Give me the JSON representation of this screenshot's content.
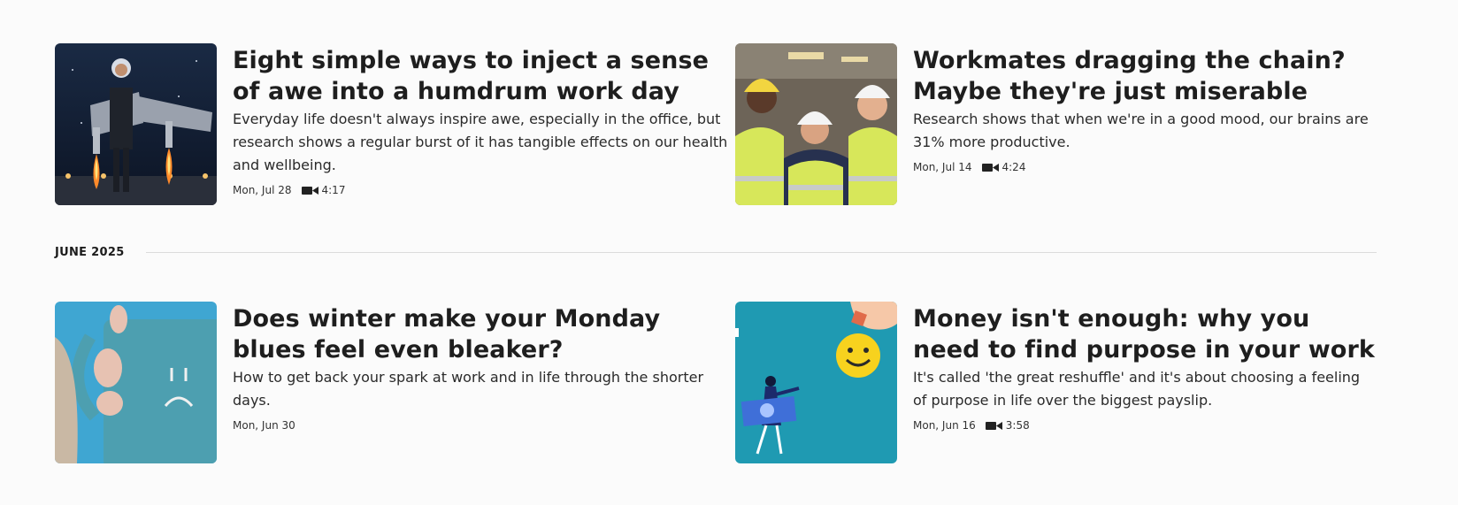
{
  "articles": [
    {
      "title": "Eight simple ways to inject a sense of awe into a humdrum work day",
      "description": "Everyday life doesn't always inspire awe, especially in the office, but research shows a regular burst of it has tangible effects on our health and wellbeing.",
      "date": "Mon, Jul 28",
      "duration": "4:17",
      "image": "jetpack-businessman"
    },
    {
      "title": "Workmates dragging the chain? Maybe they're just miserable",
      "description": "Research shows that when we're in a good mood, our brains are 31% more productive.",
      "date": "Mon, Jul 14",
      "duration": "4:24",
      "image": "construction-workers"
    },
    {
      "title": "Does winter make your Monday blues feel even bleaker?",
      "description": "How to get back your spark at work and in life through the shorter days.",
      "date": "Mon, Jun 30",
      "duration": "",
      "image": "sad-mug"
    },
    {
      "title": "Money isn't enough: why you need to find purpose in your work",
      "description": "It's called 'the great reshuffle' and it's about choosing a feeling of purpose in life over the biggest payslip.",
      "date": "Mon, Jun 16",
      "duration": "3:58",
      "image": "money-and-smile"
    }
  ],
  "section_label": "JUNE 2025",
  "colors": {
    "text": "#1e1e1e",
    "divider": "#dcdcdc",
    "background": "#fbfbfb"
  }
}
